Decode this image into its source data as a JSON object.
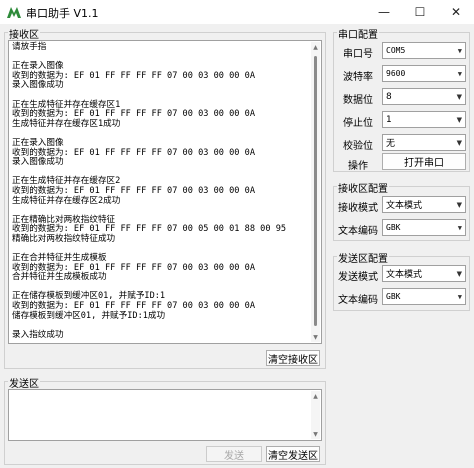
{
  "window": {
    "title": "串口助手 V1.1",
    "minimize_glyph": "—",
    "maximize_glyph": "☐",
    "close_glyph": "✕",
    "icon_color": "#2e8b3a"
  },
  "receive": {
    "group_title": "接收区",
    "lines": [
      "请放手指",
      "",
      "正在录入图像",
      "收到的数据为: EF 01 FF FF FF FF 07 00 03 00 00 0A",
      "录入图像成功",
      "",
      "正在生成特征并存在缓存区1",
      "收到的数据为: EF 01 FF FF FF FF 07 00 03 00 00 0A",
      "生成特征并存在缓存区1成功",
      "",
      "正在录入图像",
      "收到的数据为: EF 01 FF FF FF FF 07 00 03 00 00 0A",
      "录入图像成功",
      "",
      "正在生成特征并存在缓存区2",
      "收到的数据为: EF 01 FF FF FF FF 07 00 03 00 00 0A",
      "生成特征并存在缓存区2成功",
      "",
      "正在精确比对两枚指纹特征",
      "收到的数据为: EF 01 FF FF FF FF 07 00 05 00 01 88 00 95",
      "精确比对两枚指纹特征成功",
      "",
      "正在合并特征并生成模板",
      "收到的数据为: EF 01 FF FF FF FF 07 00 03 00 00 0A",
      "合并特征并生成模板成功",
      "",
      "正在储存模板到缓冲区01, 并赋予ID:1",
      "收到的数据为: EF 01 FF FF FF FF 07 00 03 00 00 0A",
      "储存模板到缓冲区01, 并赋予ID:1成功",
      "",
      "录入指纹成功"
    ],
    "clear_label": "清空接收区"
  },
  "send": {
    "group_title": "发送区",
    "value": "",
    "send_label": "发送",
    "clear_label": "清空发送区"
  },
  "serial_config": {
    "group_title": "串口配置",
    "port_label": "串口号",
    "port_value": "COM5",
    "baud_label": "波特率",
    "baud_value": "9600",
    "databits_label": "数据位",
    "databits_value": "8",
    "stopbits_label": "停止位",
    "stopbits_value": "1",
    "parity_label": "校验位",
    "parity_value": "无",
    "operation_label": "操作",
    "open_button_label": "打开串口"
  },
  "receive_config": {
    "group_title": "接收区配置",
    "mode_label": "接收模式",
    "mode_value": "文本模式",
    "encoding_label": "文本编码",
    "encoding_value": "GBK"
  },
  "send_config": {
    "group_title": "发送区配置",
    "mode_label": "发送模式",
    "mode_value": "文本模式",
    "encoding_label": "文本编码",
    "encoding_value": "GBK"
  }
}
